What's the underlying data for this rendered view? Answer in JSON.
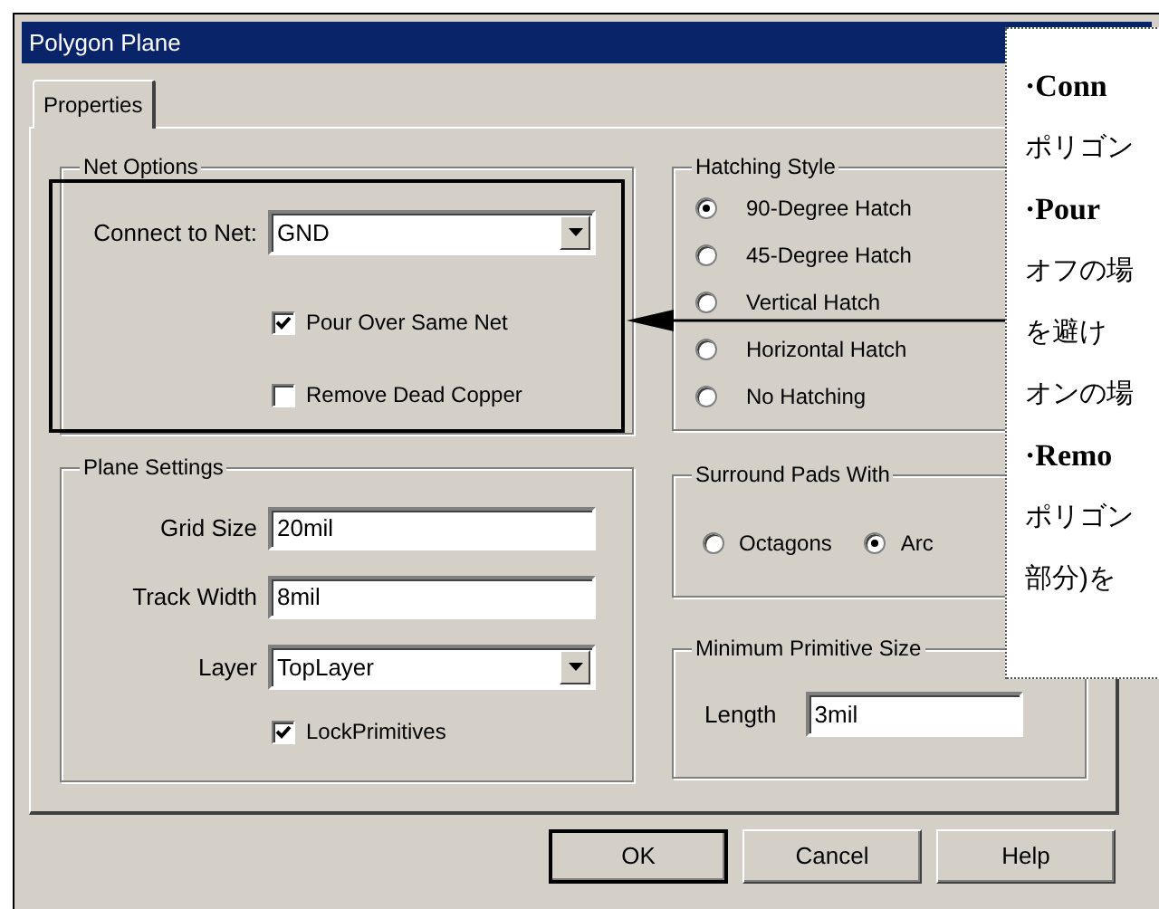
{
  "window": {
    "title": "Polygon Plane"
  },
  "tabs": [
    {
      "label": "Properties",
      "selected": true
    }
  ],
  "net_options": {
    "title": "Net Options",
    "connect_label": "Connect to Net:",
    "net": "GND",
    "checkboxes": [
      {
        "label": "Pour Over Same Net",
        "checked": true
      },
      {
        "label": "Remove Dead Copper",
        "checked": false
      }
    ]
  },
  "hatching_style": {
    "title": "Hatching Style",
    "options": [
      {
        "label": "90-Degree Hatch",
        "selected": true
      },
      {
        "label": "45-Degree Hatch",
        "selected": false
      },
      {
        "label": "Vertical Hatch",
        "selected": false
      },
      {
        "label": "Horizontal Hatch",
        "selected": false
      },
      {
        "label": "No Hatching",
        "selected": false
      }
    ]
  },
  "plane_settings": {
    "title": "Plane Settings",
    "fields": [
      {
        "kind": "text",
        "label": "Grid Size",
        "value": "20mil"
      },
      {
        "kind": "text",
        "label": "Track Width",
        "value": "8mil"
      },
      {
        "kind": "dropdown",
        "label": "Layer",
        "value": "TopLayer"
      }
    ],
    "checkboxes": [
      {
        "label": "LockPrimitives",
        "checked": true
      }
    ]
  },
  "surround_pads": {
    "title": "Surround Pads With",
    "options": [
      {
        "label": "Octagons",
        "selected": false
      },
      {
        "label": "Arc",
        "selected": true
      }
    ]
  },
  "minimum_primitive_size": {
    "title": "Minimum Primitive Size",
    "label": "Length",
    "value": "3mil"
  },
  "buttons": [
    {
      "label": "OK",
      "default": true
    },
    {
      "label": "Cancel",
      "default": false
    },
    {
      "label": "Help",
      "default": false
    }
  ],
  "callout": {
    "lines": [
      {
        "kind": "heading",
        "text": "·Conn"
      },
      {
        "kind": "body",
        "text": "ポリゴン"
      },
      {
        "kind": "heading",
        "text": "·Pour"
      },
      {
        "kind": "body",
        "text": "オフの場"
      },
      {
        "kind": "body",
        "text": "を避け"
      },
      {
        "kind": "body",
        "text": "オンの場"
      },
      {
        "kind": "heading",
        "text": "·Remo"
      },
      {
        "kind": "body",
        "text": "ポリゴン"
      },
      {
        "kind": "body",
        "text": "部分)を"
      }
    ]
  }
}
